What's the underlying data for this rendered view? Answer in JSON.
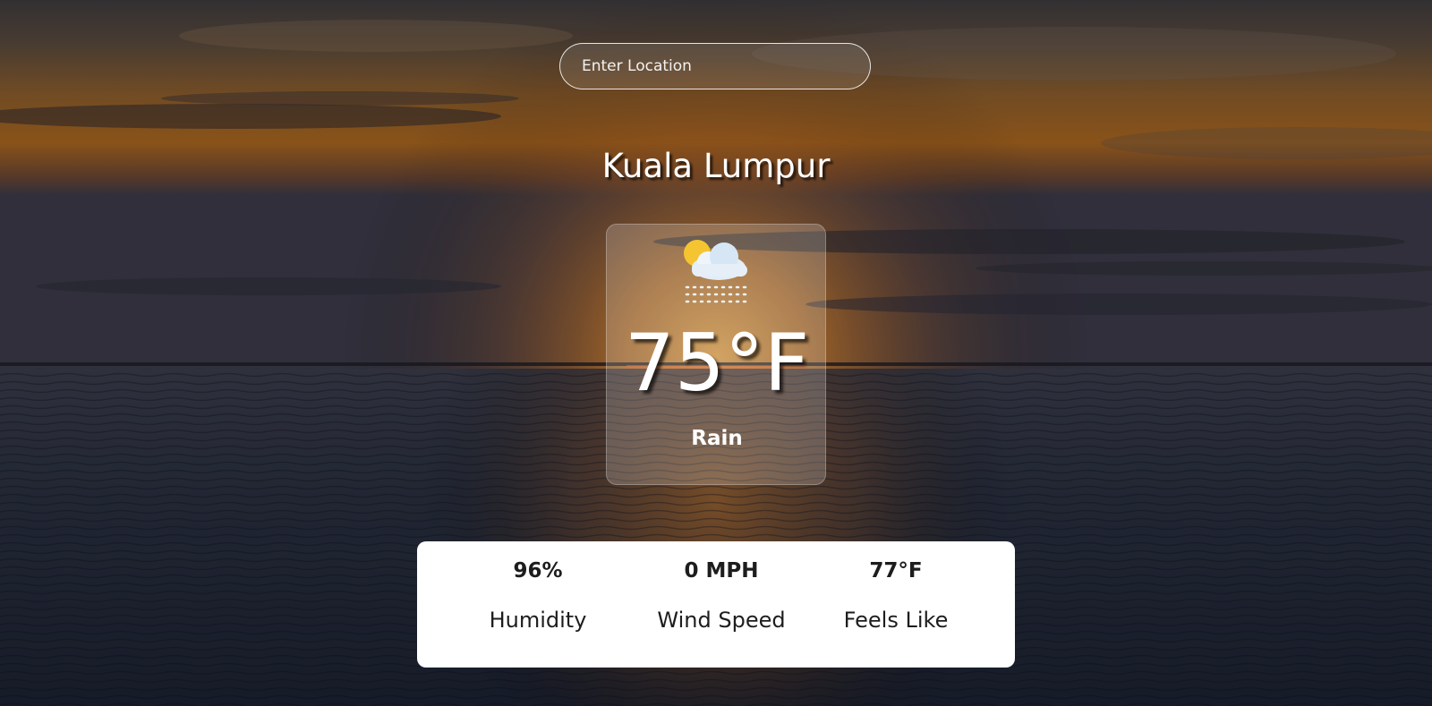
{
  "search": {
    "placeholder": "Enter Location",
    "value": ""
  },
  "location": {
    "city": "Kuala Lumpur"
  },
  "current": {
    "temperature": "75°F",
    "condition": "Rain",
    "icon": "partly-cloudy-rain-icon"
  },
  "details": {
    "humidity_value": "96%",
    "humidity_label": "Humidity",
    "wind_value": "0 MPH",
    "wind_label": "Wind Speed",
    "feels_value": "77°F",
    "feels_label": "Feels Like"
  },
  "colors": {
    "card_text": "#ffffff",
    "panel_background": "#ffffff",
    "panel_text": "#1d1d1d"
  }
}
